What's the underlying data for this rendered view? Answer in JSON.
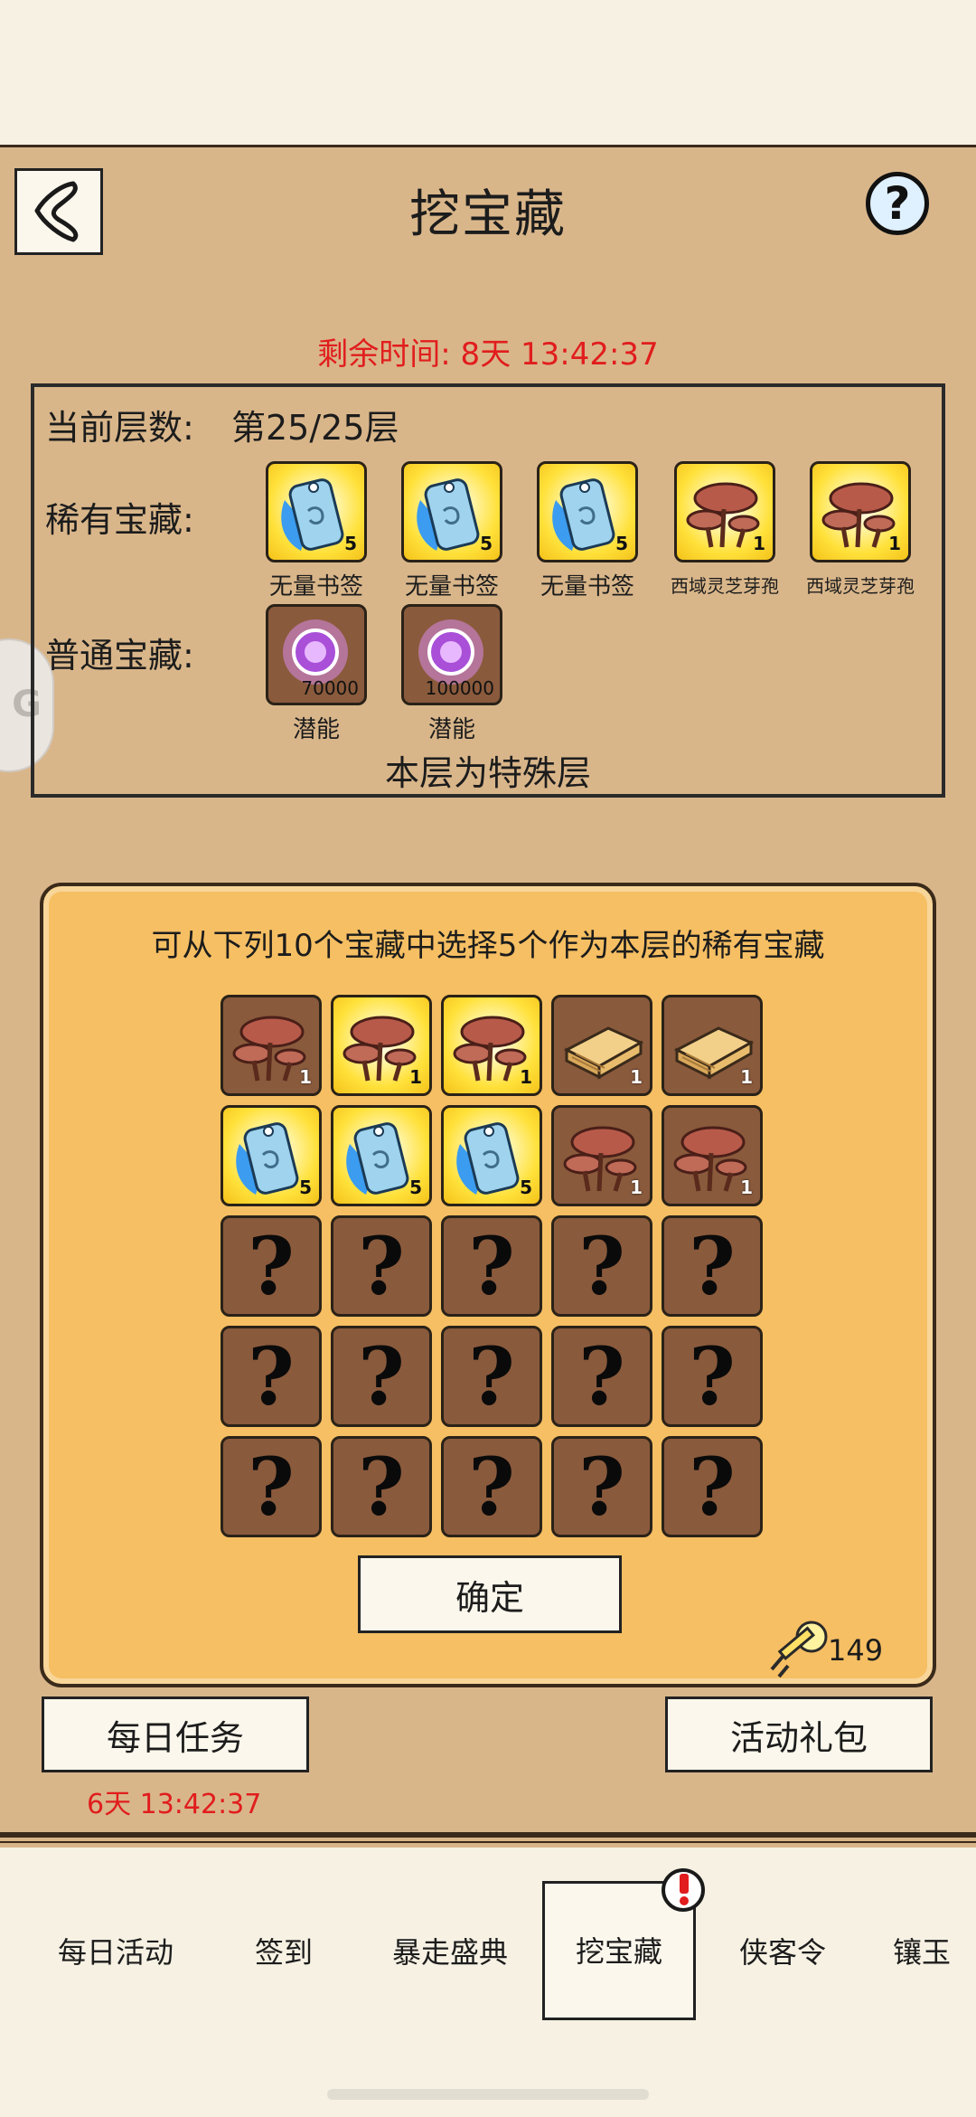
{
  "header": {
    "title": "挖宝藏",
    "help_symbol": "?"
  },
  "timer": {
    "remaining_label": "剩余时间: 8天 13:42:37"
  },
  "floor_info": {
    "floor_label": "当前层数:",
    "floor_value": "第25/25层",
    "rare_label": "稀有宝藏:",
    "normal_label": "普通宝藏:",
    "special_note": "本层为特殊层",
    "rare_items": [
      {
        "name": "无量书签",
        "qty": "5",
        "icon": "bookmark-icon"
      },
      {
        "name": "无量书签",
        "qty": "5",
        "icon": "bookmark-icon"
      },
      {
        "name": "无量书签",
        "qty": "5",
        "icon": "bookmark-icon"
      },
      {
        "name": "西域灵芝芽孢",
        "qty": "1",
        "icon": "lingzhi-icon"
      },
      {
        "name": "西域灵芝芽孢",
        "qty": "1",
        "icon": "lingzhi-icon"
      }
    ],
    "normal_items": [
      {
        "name": "潜能",
        "qty": "70000",
        "icon": "potential-orb-icon"
      },
      {
        "name": "潜能",
        "qty": "100000",
        "icon": "potential-orb-icon"
      }
    ]
  },
  "selection": {
    "instruction": "可从下列10个宝藏中选择5个作为本层的稀有宝藏",
    "grid": [
      [
        {
          "type": "lingzhi",
          "bg": "brown",
          "qty": "1"
        },
        {
          "type": "lingzhi",
          "bg": "gold",
          "qty": "1"
        },
        {
          "type": "lingzhi",
          "bg": "gold",
          "qty": "1"
        },
        {
          "type": "book",
          "bg": "brown",
          "qty": "1"
        },
        {
          "type": "book",
          "bg": "brown",
          "qty": "1"
        }
      ],
      [
        {
          "type": "bookmark",
          "bg": "gold",
          "qty": "5"
        },
        {
          "type": "bookmark",
          "bg": "gold",
          "qty": "5"
        },
        {
          "type": "bookmark",
          "bg": "gold",
          "qty": "5"
        },
        {
          "type": "lingzhi",
          "bg": "brown",
          "qty": "1"
        },
        {
          "type": "lingzhi",
          "bg": "brown",
          "qty": "1"
        }
      ]
    ],
    "unknown_symbol": "?",
    "confirm_label": "确定",
    "key_count": "149"
  },
  "buttons": {
    "daily_task": "每日任务",
    "daily_task_timer": "6天 13:42:37",
    "gift_pack": "活动礼包"
  },
  "tabs": [
    "每日活动",
    "签到",
    "暴走盛典",
    "挖宝藏",
    "侠客令",
    "镶玉"
  ],
  "active_tab": "挖宝藏",
  "side_badge_text": "G",
  "colors": {
    "panel_bg": "#d9b68a",
    "select_bg": "#f6bf63",
    "timer_red": "#e11d1d",
    "brown_tile": "#8a5a3c",
    "gold_tile": "#ffe13a"
  }
}
